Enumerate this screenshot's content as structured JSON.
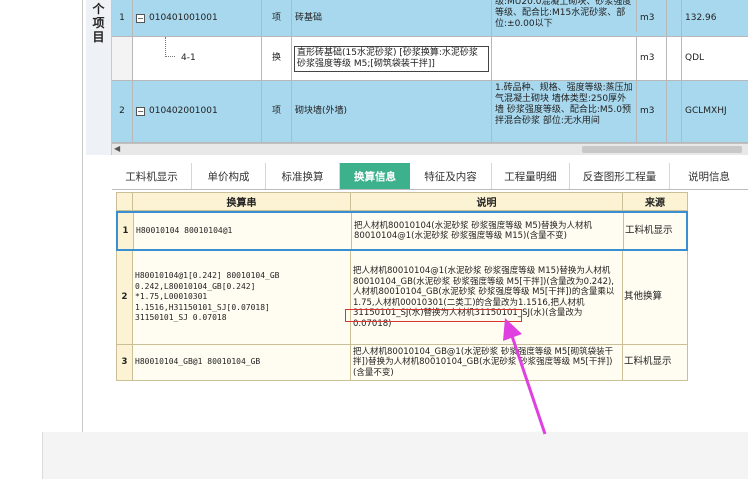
{
  "side_label": [
    "个",
    "项",
    "目"
  ],
  "upper_rows": [
    {
      "index": "1",
      "code": "010401001001",
      "type": "项",
      "name": "砖基础",
      "description": "级:MU20.0混凝土砌块、砂浆强度等级、配合比:M15水泥砂浆、部位:±0.00以下",
      "unit": "m3",
      "quantity": "132.96"
    },
    {
      "index": "",
      "code": "4-1",
      "type": "换",
      "name": "直形砖基础(15水泥砂浆) [砂浆换算:水泥砂浆 砂浆强度等级 M5;[砌筑袋装干拌]]",
      "description": "",
      "unit": "m3",
      "quantity": "QDL"
    },
    {
      "index": "2",
      "code": "010402001001",
      "type": "项",
      "name": "砌块墙(外墙)",
      "description": "1.砖品种、规格、强度等级:蒸压加气混凝土砌块 墙体类型:250厚外墙 砂浆强度等级、配合比:M5.0预拌混合砂浆 部位:无水用间",
      "unit": "m3",
      "quantity": "GCLMXHJ"
    }
  ],
  "tabs": [
    "工料机显示",
    "单价构成",
    "标准换算",
    "换算信息",
    "特征及内容",
    "工程量明细",
    "反查图形工程量",
    "说明信息"
  ],
  "active_tab": "换算信息",
  "table": {
    "headers": [
      "换算串",
      "说明",
      "来源"
    ],
    "rows": [
      {
        "index": "1",
        "string": "H80010104 80010104@1",
        "description": "把人材机80010104(水泥砂浆 砂浆强度等级 M5)替换为人材机80010104@1(水泥砂浆 砂浆强度等级 M15)(含量不变)",
        "source": "工料机显示"
      },
      {
        "index": "2",
        "string": "H80010104@1[0.242] 80010104_GB\n0.242,L80010104_GB[0.242]\n*1.75,L00010301\n1.1516,H31150101_SJ[0.07018]\n31150101_SJ 0.07018",
        "description": "把人材机80010104@1(水泥砂浆 砂浆强度等级 M15)替换为人材机80010104_GB(水泥砂浆 砂浆强度等级 M5[干拌])(含量改为0.242),人材机80010104_GB(水泥砂浆 砂浆强度等级 M5[干拌])的含量乘以1.75,人材机00010301(二类工)的含量改为1.1516,把人材机31150101_SJ(水)替换为人材机31150101_SJ(水)(含量改为0.07018)",
        "source": "其他换算"
      },
      {
        "index": "3",
        "string": "H80010104_GB@1 80010104_GB",
        "description": "把人材机80010104_GB@1(水泥砂浆 砂浆强度等级 M5[砌筑袋装干拌])替换为人材机80010104_GB(水泥砂浆 砂浆强度等级 M5[干拌])(含量不变)",
        "source": "工料机显示"
      }
    ]
  },
  "colors": {
    "active_tab": "#3db08c",
    "row_highlight": "#a8d8ee",
    "annotation_arrow": "#e040e0",
    "annotation_box": "#dd3333"
  }
}
